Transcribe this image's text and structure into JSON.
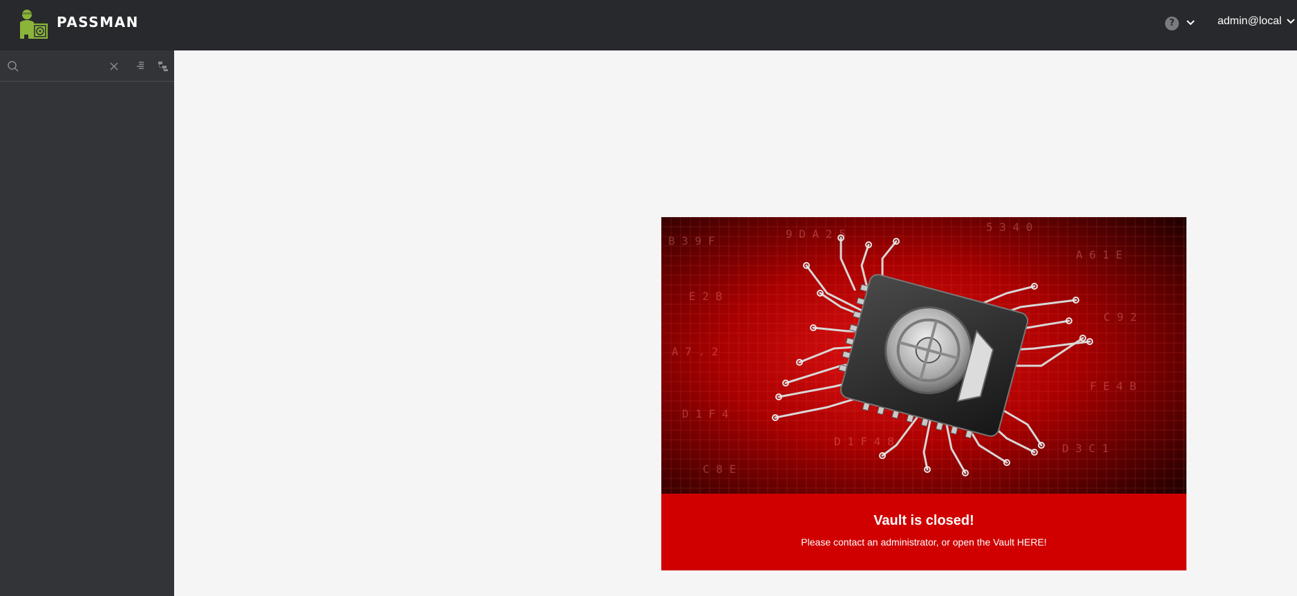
{
  "app": {
    "brand": "PASSMAN",
    "logo_icon": "passman-logo-icon"
  },
  "header": {
    "help_label": "?",
    "user": "admin@local"
  },
  "sidebar": {
    "search": {
      "value": "",
      "placeholder": ""
    },
    "icons": [
      "search-icon",
      "clear-icon",
      "sort-icon",
      "tree-icon"
    ]
  },
  "vault": {
    "image_icon": "vault-chip-illustration",
    "title": "Vault is closed!",
    "message_prefix": "Please contact an administrator, or open the Vault ",
    "link_text": "HERE!"
  },
  "colors": {
    "topbar": "#28292c",
    "sidebar": "#333437",
    "content": "#f5f5f5",
    "banner": "#d10000",
    "logo_green": "#8ab53a"
  }
}
